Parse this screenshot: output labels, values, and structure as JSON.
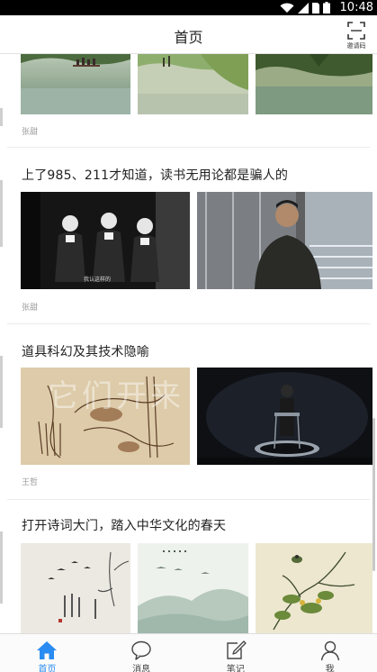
{
  "status_bar": {
    "time": "10:48"
  },
  "header": {
    "title": "首页",
    "scan_label": "邀请码"
  },
  "feed": {
    "partial_card": {
      "author": "张甜"
    },
    "cards": [
      {
        "title": "上了985、211才知道，读书无用论都是骗人的",
        "author": "张甜",
        "caption": "我认这样的"
      },
      {
        "title": "道具科幻及其技术隐喻",
        "author": "王哲",
        "overlay_text": "它们开来"
      },
      {
        "title": "打开诗词大门，踏入中华文化的春天"
      }
    ]
  },
  "tabbar": {
    "tabs": [
      {
        "label": "首页",
        "icon": "home-icon",
        "active": true
      },
      {
        "label": "消息",
        "icon": "chat-bubble-icon",
        "active": false
      },
      {
        "label": "笔记",
        "icon": "edit-note-icon",
        "active": false
      },
      {
        "label": "我",
        "icon": "person-icon",
        "active": false
      }
    ]
  },
  "colors": {
    "accent": "#2a8bf2",
    "status_bar": "#000000",
    "text_primary": "#222222",
    "text_secondary": "#9a9a9a"
  }
}
